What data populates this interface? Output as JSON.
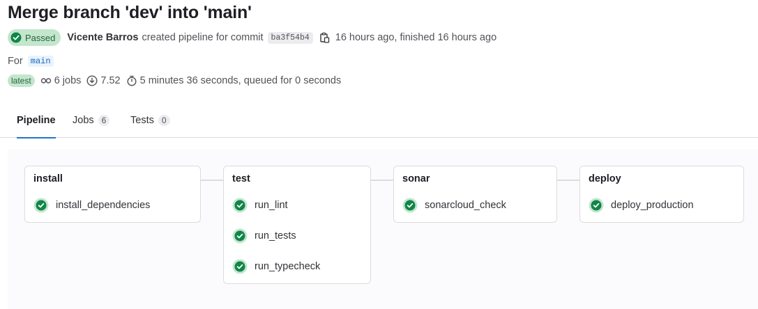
{
  "header": {
    "title": "Merge branch 'dev' into 'main'"
  },
  "status": {
    "label": "Passed",
    "icon": "check-circle-icon",
    "color": "#108548"
  },
  "commit": {
    "author": "Vicente Barros",
    "action_text": "created pipeline for commit",
    "sha": "ba3f54b4",
    "time_text": "16 hours ago, finished 16 hours ago"
  },
  "ref": {
    "prefix": "For",
    "branch": "main"
  },
  "stats": {
    "latest_label": "latest",
    "jobs": "6 jobs",
    "score": "7.52",
    "duration": "5 minutes 36 seconds, queued for 0 seconds"
  },
  "tabs": [
    {
      "label": "Pipeline",
      "count": null,
      "active": true
    },
    {
      "label": "Jobs",
      "count": "6",
      "active": false
    },
    {
      "label": "Tests",
      "count": "0",
      "active": false
    }
  ],
  "stages": [
    {
      "name": "install",
      "jobs": [
        "install_dependencies"
      ]
    },
    {
      "name": "test",
      "jobs": [
        "run_lint",
        "run_tests",
        "run_typecheck"
      ]
    },
    {
      "name": "sonar",
      "jobs": [
        "sonarcloud_check"
      ]
    },
    {
      "name": "deploy",
      "jobs": [
        "deploy_production"
      ]
    }
  ],
  "colors": {
    "success": "#108548",
    "success_bg": "#c3e6cd",
    "tab_active": "#1f75cb"
  }
}
